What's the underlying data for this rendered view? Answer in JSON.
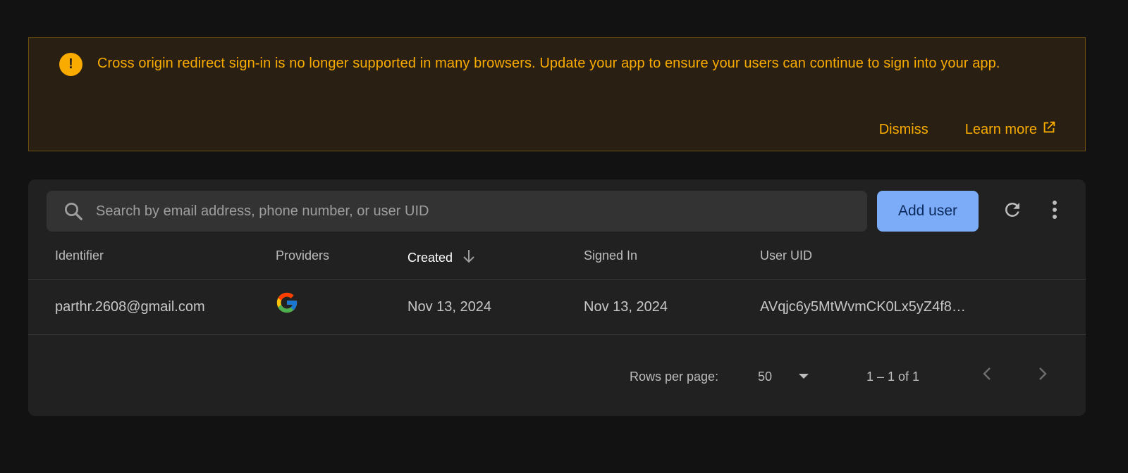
{
  "banner": {
    "icon": "warning-exclamation-icon",
    "message": "Cross origin redirect sign-in is no longer supported in many browsers. Update your app to ensure your users can continue to sign into your app.",
    "dismiss_label": "Dismiss",
    "learn_more_label": "Learn more",
    "learn_more_icon": "external-link-icon",
    "accent_color": "#f9ab00"
  },
  "toolbar": {
    "search_placeholder": "Search by email address, phone number, or user UID",
    "search_value": "",
    "add_user_label": "Add user",
    "refresh_icon": "refresh-icon",
    "more_icon": "more-vert-icon"
  },
  "table": {
    "columns": [
      {
        "label": "Identifier"
      },
      {
        "label": "Providers"
      },
      {
        "label": "Created",
        "sorted": "desc",
        "sort_icon": "arrow-down-icon"
      },
      {
        "label": "Signed In"
      },
      {
        "label": "User UID"
      }
    ],
    "rows": [
      {
        "identifier": "parthr.2608@gmail.com",
        "provider_icon": "google-icon",
        "created": "Nov 13, 2024",
        "signed_in": "Nov 13, 2024",
        "user_uid": "AVqjc6y5MtWvmCK0Lx5yZ4f8…"
      }
    ]
  },
  "pagination": {
    "rows_per_page_label": "Rows per page:",
    "rows_per_page_value": "50",
    "range_label": "1 – 1 of 1",
    "prev_icon": "chevron-left-icon",
    "next_icon": "chevron-right-icon"
  },
  "colors": {
    "primary_button": "#7cacf8",
    "warning": "#f9ab00",
    "surface": "#212121",
    "background": "#121212"
  }
}
